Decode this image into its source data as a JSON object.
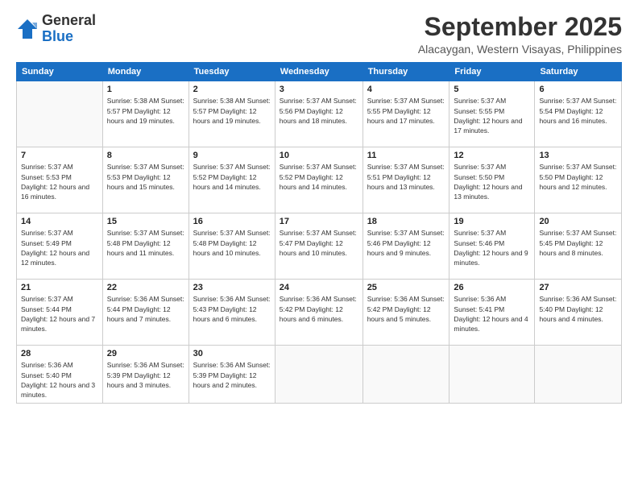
{
  "logo": {
    "general": "General",
    "blue": "Blue"
  },
  "title": "September 2025",
  "location": "Alacaygan, Western Visayas, Philippines",
  "headers": [
    "Sunday",
    "Monday",
    "Tuesday",
    "Wednesday",
    "Thursday",
    "Friday",
    "Saturday"
  ],
  "weeks": [
    [
      {
        "day": "",
        "info": ""
      },
      {
        "day": "1",
        "info": "Sunrise: 5:38 AM\nSunset: 5:57 PM\nDaylight: 12 hours\nand 19 minutes."
      },
      {
        "day": "2",
        "info": "Sunrise: 5:38 AM\nSunset: 5:57 PM\nDaylight: 12 hours\nand 19 minutes."
      },
      {
        "day": "3",
        "info": "Sunrise: 5:37 AM\nSunset: 5:56 PM\nDaylight: 12 hours\nand 18 minutes."
      },
      {
        "day": "4",
        "info": "Sunrise: 5:37 AM\nSunset: 5:55 PM\nDaylight: 12 hours\nand 17 minutes."
      },
      {
        "day": "5",
        "info": "Sunrise: 5:37 AM\nSunset: 5:55 PM\nDaylight: 12 hours\nand 17 minutes."
      },
      {
        "day": "6",
        "info": "Sunrise: 5:37 AM\nSunset: 5:54 PM\nDaylight: 12 hours\nand 16 minutes."
      }
    ],
    [
      {
        "day": "7",
        "info": "Sunrise: 5:37 AM\nSunset: 5:53 PM\nDaylight: 12 hours\nand 16 minutes."
      },
      {
        "day": "8",
        "info": "Sunrise: 5:37 AM\nSunset: 5:53 PM\nDaylight: 12 hours\nand 15 minutes."
      },
      {
        "day": "9",
        "info": "Sunrise: 5:37 AM\nSunset: 5:52 PM\nDaylight: 12 hours\nand 14 minutes."
      },
      {
        "day": "10",
        "info": "Sunrise: 5:37 AM\nSunset: 5:52 PM\nDaylight: 12 hours\nand 14 minutes."
      },
      {
        "day": "11",
        "info": "Sunrise: 5:37 AM\nSunset: 5:51 PM\nDaylight: 12 hours\nand 13 minutes."
      },
      {
        "day": "12",
        "info": "Sunrise: 5:37 AM\nSunset: 5:50 PM\nDaylight: 12 hours\nand 13 minutes."
      },
      {
        "day": "13",
        "info": "Sunrise: 5:37 AM\nSunset: 5:50 PM\nDaylight: 12 hours\nand 12 minutes."
      }
    ],
    [
      {
        "day": "14",
        "info": "Sunrise: 5:37 AM\nSunset: 5:49 PM\nDaylight: 12 hours\nand 12 minutes."
      },
      {
        "day": "15",
        "info": "Sunrise: 5:37 AM\nSunset: 5:48 PM\nDaylight: 12 hours\nand 11 minutes."
      },
      {
        "day": "16",
        "info": "Sunrise: 5:37 AM\nSunset: 5:48 PM\nDaylight: 12 hours\nand 10 minutes."
      },
      {
        "day": "17",
        "info": "Sunrise: 5:37 AM\nSunset: 5:47 PM\nDaylight: 12 hours\nand 10 minutes."
      },
      {
        "day": "18",
        "info": "Sunrise: 5:37 AM\nSunset: 5:46 PM\nDaylight: 12 hours\nand 9 minutes."
      },
      {
        "day": "19",
        "info": "Sunrise: 5:37 AM\nSunset: 5:46 PM\nDaylight: 12 hours\nand 9 minutes."
      },
      {
        "day": "20",
        "info": "Sunrise: 5:37 AM\nSunset: 5:45 PM\nDaylight: 12 hours\nand 8 minutes."
      }
    ],
    [
      {
        "day": "21",
        "info": "Sunrise: 5:37 AM\nSunset: 5:44 PM\nDaylight: 12 hours\nand 7 minutes."
      },
      {
        "day": "22",
        "info": "Sunrise: 5:36 AM\nSunset: 5:44 PM\nDaylight: 12 hours\nand 7 minutes."
      },
      {
        "day": "23",
        "info": "Sunrise: 5:36 AM\nSunset: 5:43 PM\nDaylight: 12 hours\nand 6 minutes."
      },
      {
        "day": "24",
        "info": "Sunrise: 5:36 AM\nSunset: 5:42 PM\nDaylight: 12 hours\nand 6 minutes."
      },
      {
        "day": "25",
        "info": "Sunrise: 5:36 AM\nSunset: 5:42 PM\nDaylight: 12 hours\nand 5 minutes."
      },
      {
        "day": "26",
        "info": "Sunrise: 5:36 AM\nSunset: 5:41 PM\nDaylight: 12 hours\nand 4 minutes."
      },
      {
        "day": "27",
        "info": "Sunrise: 5:36 AM\nSunset: 5:40 PM\nDaylight: 12 hours\nand 4 minutes."
      }
    ],
    [
      {
        "day": "28",
        "info": "Sunrise: 5:36 AM\nSunset: 5:40 PM\nDaylight: 12 hours\nand 3 minutes."
      },
      {
        "day": "29",
        "info": "Sunrise: 5:36 AM\nSunset: 5:39 PM\nDaylight: 12 hours\nand 3 minutes."
      },
      {
        "day": "30",
        "info": "Sunrise: 5:36 AM\nSunset: 5:39 PM\nDaylight: 12 hours\nand 2 minutes."
      },
      {
        "day": "",
        "info": ""
      },
      {
        "day": "",
        "info": ""
      },
      {
        "day": "",
        "info": ""
      },
      {
        "day": "",
        "info": ""
      }
    ]
  ]
}
